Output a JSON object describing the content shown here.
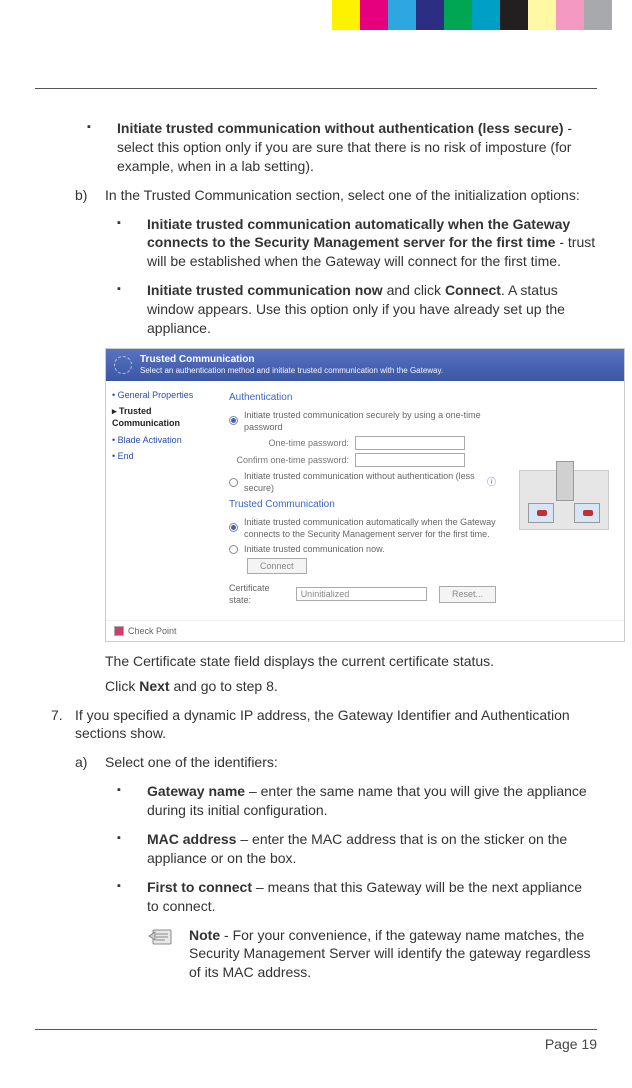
{
  "color_bar": [
    "#fff200",
    "#e6007e",
    "#2ea7e0",
    "#2b2e83",
    "#00a651",
    "#00a0c6",
    "#231f20",
    "#fff9a6",
    "#f49ac1",
    "#a7a9ac"
  ],
  "bullets_top": [
    {
      "bold": "Initiate trusted communication without authentication (less secure)",
      "rest": " - select this option only if you are sure that there is no risk of imposture (for example, when in a lab setting)."
    }
  ],
  "letter_b": {
    "marker": "b)",
    "text": "In the Trusted Communication section, select one of the initialization options:",
    "bullets": [
      {
        "bold": "Initiate trusted communication automatically when the Gateway connects to the Security Management server for the first time",
        "rest": " - trust will be established when the Gateway will connect for the first time."
      },
      {
        "bold": "Initiate trusted communication now",
        "mid": " and click ",
        "bold2": "Connect",
        "rest": ". A status window appears. Use this option only if you have already set up the appliance."
      }
    ]
  },
  "gui": {
    "header_title": "Trusted Communication",
    "header_sub": "Select an authentication method and initiate trusted communication with the Gateway.",
    "nav": {
      "general": "General Properties",
      "trusted": "Trusted Communication",
      "blade": "Blade Activation",
      "end": "End"
    },
    "auth_title": "Authentication",
    "radio1": "Initiate trusted communication securely by using a one-time password",
    "otp_label": "One-time password:",
    "confirm_label": "Confirm one-time password:",
    "radio2": "Initiate trusted communication without authentication (less secure)",
    "tc_title": "Trusted Communication",
    "radio3": "Initiate trusted communication automatically when the Gateway connects to the Security Management server for the first time.",
    "radio4": "Initiate trusted communication now.",
    "connect_btn": "Connect",
    "cert_label": "Certificate state:",
    "cert_value": "Uninitialized",
    "reset_btn": "Reset...",
    "logo": "Check Point"
  },
  "after_gui": {
    "p1": "The Certificate state field displays the current certificate status.",
    "p2_pre": "Click ",
    "p2_bold": "Next",
    "p2_post": " and go to step 8."
  },
  "step7": {
    "marker": "7.",
    "text": "If you specified a dynamic IP address, the Gateway Identifier and Authentication sections show.",
    "letter_a": {
      "marker": "a)",
      "text": "Select one of the identifiers:",
      "bullets": [
        {
          "bold": "Gateway name",
          "rest": " – enter the same name that you will give the appliance during its initial configuration."
        },
        {
          "bold": "MAC address",
          "rest": " – enter the MAC address that is on the sticker on the appliance or on the box."
        },
        {
          "bold": "First to connect",
          "rest": " – means that this Gateway will be the next appliance to connect."
        }
      ]
    }
  },
  "note": {
    "bold": "Note",
    "text": " - For your convenience, if the gateway name matches, the Security Management Server will identify the gateway regardless of its MAC address."
  },
  "page_number": "Page 19"
}
